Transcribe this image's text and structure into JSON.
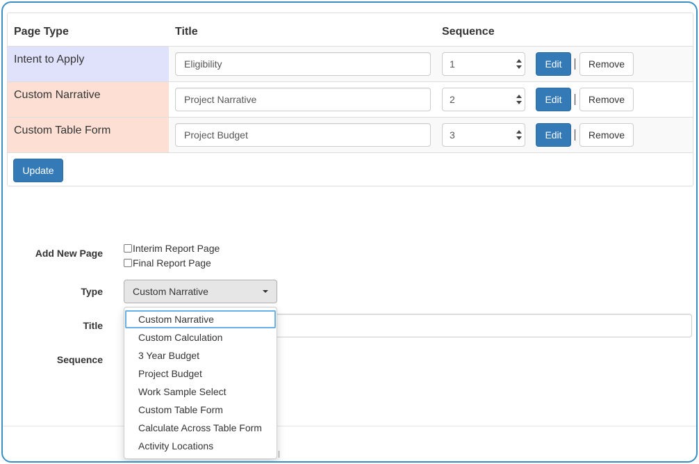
{
  "table": {
    "headers": {
      "page_type": "Page Type",
      "title": "Title",
      "sequence": "Sequence"
    },
    "rows": [
      {
        "page_type": "Intent to Apply",
        "title": "Eligibility",
        "sequence": "1",
        "edit": "Edit",
        "remove": "Remove",
        "color": "#e0e2fb"
      },
      {
        "page_type": "Custom Narrative",
        "title": "Project Narrative",
        "sequence": "2",
        "edit": "Edit",
        "remove": "Remove",
        "color": "#fde0d3"
      },
      {
        "page_type": "Custom Table Form",
        "title": "Project Budget",
        "sequence": "3",
        "edit": "Edit",
        "remove": "Remove",
        "color": "#fde0d3"
      }
    ],
    "separator": "|",
    "update_label": "Update"
  },
  "add_page": {
    "label": "Add New Page",
    "checkboxes": [
      {
        "label": "Interim Report Page",
        "checked": false
      },
      {
        "label": "Final Report Page",
        "checked": false
      }
    ],
    "type_label": "Type",
    "type_selected": "Custom Narrative",
    "title_label": "Title",
    "sequence_label": "Sequence",
    "type_options": [
      "Custom Narrative",
      "Custom Calculation",
      "3 Year Budget",
      "Project Budget",
      "Work Sample Select",
      "Custom Table Form",
      "Calculate Across Table Form",
      "Activity Locations"
    ]
  },
  "colors": {
    "primary": "#337ab7",
    "frame_border": "#3b8ec2",
    "focus": "#66afe9"
  }
}
